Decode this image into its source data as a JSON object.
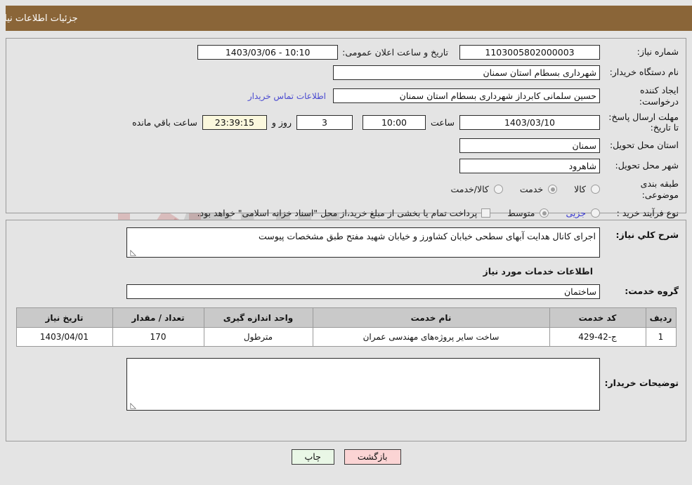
{
  "header": {
    "title": "جزئیات اطلاعات نیاز",
    "bar_color": "#8a6538"
  },
  "watermark": {
    "text1": "ArIa",
    "text2": "Tender.net"
  },
  "top_panel": {
    "need_number": {
      "label": "شماره نیاز:",
      "value": "1103005802000003"
    },
    "announce": {
      "label": "تاریخ و ساعت اعلان عمومی:",
      "value": "10:10 - 1403/03/06"
    },
    "buyer_org": {
      "label": "نام دستگاه خریدار:",
      "value": "شهرداری بسطام استان سمنان"
    },
    "requester": {
      "label": "ایجاد کننده درخواست:",
      "value": "حسین سلمانی کابرداز شهرداری بسطام استان سمنان",
      "contact_link": "اطلاعات تماس خریدار"
    },
    "deadline": {
      "label": "مهلت ارسال پاسخ: تا تاریخ:",
      "date_value": "1403/03/10",
      "time_label": "ساعت",
      "time_value": "10:00",
      "days_value": "3",
      "days_label": "روز و",
      "countdown_value": "23:39:15",
      "remaining_label": "ساعت باقي مانده"
    },
    "province": {
      "label": "استان محل تحویل:",
      "value": "سمنان"
    },
    "city": {
      "label": "شهر محل تحویل:",
      "value": "شاهرود"
    },
    "category": {
      "label": "طبقه بندی موضوعی:",
      "options": [
        {
          "label": "کالا",
          "selected": false
        },
        {
          "label": "خدمت",
          "selected": true
        },
        {
          "label": "کالا/خدمت",
          "selected": false
        }
      ]
    },
    "purchase_type": {
      "label": "نوع فرآیند خرید :",
      "options": [
        {
          "label": "جزیی",
          "selected": false
        },
        {
          "label": "متوسط",
          "selected": true
        }
      ],
      "treasury_checkbox_checked": false,
      "treasury_note": "پرداخت تمام یا بخشی از مبلغ خرید،از محل \"اسناد خزانه اسلامی\" خواهد بود."
    }
  },
  "mid_panel": {
    "general_desc": {
      "label": "شرح کلي نیاز:",
      "value": "اجرای کانال هدایت آبهای سطحی خیابان کشاورز و خیابان شهید مفتح طبق مشخصات پیوست"
    },
    "services_section_title": "اطلاعات خدمات مورد نیاز",
    "service_group": {
      "label": "گروه خدمت:",
      "value": "ساختمان"
    },
    "table": {
      "columns": [
        "ردیف",
        "کد خدمت",
        "نام خدمت",
        "واحد اندازه گیری",
        "تعداد / مقدار",
        "تاریخ نیاز"
      ],
      "rows": [
        {
          "radif": "1",
          "code": "ج-42-429",
          "name": "ساخت سایر پروژه‌های مهندسی عمران",
          "unit": "مترطول",
          "quantity": "170",
          "need_date": "1403/04/01"
        }
      ]
    },
    "buyer_notes": {
      "label": "توضیحات خریدار:",
      "value": ""
    }
  },
  "footer": {
    "print_label": "چاپ",
    "back_label": "بازگشت",
    "print_color": "#e9f7e6",
    "back_color": "#fbd4d4"
  }
}
